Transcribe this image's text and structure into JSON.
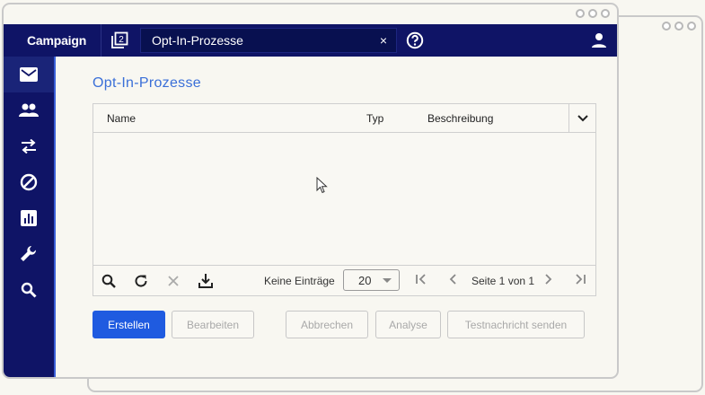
{
  "app": {
    "brand": "Campaign",
    "pages_count": "2"
  },
  "tab": {
    "label": "Opt-In-Prozesse",
    "close": "×"
  },
  "sidebar": {
    "items": [
      "mail",
      "users",
      "transfer",
      "blocked",
      "reports",
      "tools",
      "search"
    ]
  },
  "page": {
    "title": "Opt-In-Prozesse"
  },
  "table": {
    "columns": [
      "Name",
      "Typ",
      "Beschreibung"
    ],
    "rows": [],
    "footer": {
      "entries_label": "Keine Einträge",
      "page_size": "20",
      "page_info": "Seite 1 von 1"
    }
  },
  "actions": {
    "create": "Erstellen",
    "edit": "Bearbeiten",
    "cancel": "Abbrechen",
    "analyse": "Analyse",
    "test_message": "Testnachricht senden"
  },
  "colors": {
    "nav": "#0f1466",
    "accent": "#1f5be0",
    "title": "#3a6fd8"
  }
}
